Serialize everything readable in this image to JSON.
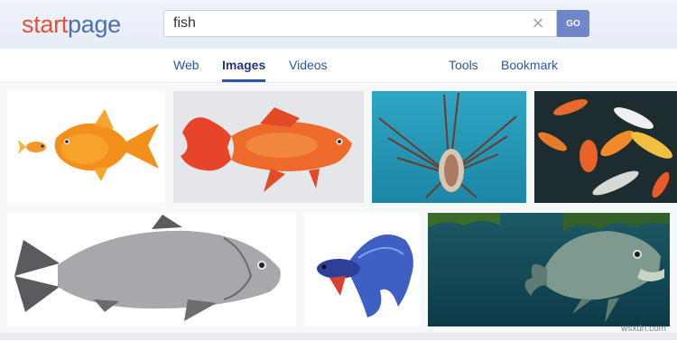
{
  "brand": {
    "logo_start": "start",
    "logo_page": "page",
    "logo_color_start": "#e8503a",
    "logo_color_page": "#4d6fb4"
  },
  "search": {
    "value": "fish",
    "placeholder": "",
    "go_label": "GO"
  },
  "nav": {
    "web": "Web",
    "images": "Images",
    "videos": "Videos",
    "tools": "Tools",
    "bookmark": "Bookmark",
    "active": "Images"
  },
  "results": {
    "images": [
      {
        "subject": "two goldfish on white"
      },
      {
        "subject": "goldfish on white background"
      },
      {
        "subject": "lionfish underwater"
      },
      {
        "subject": "koi fish in pond"
      },
      {
        "subject": "carp fish on white"
      },
      {
        "subject": "blue betta fish"
      },
      {
        "subject": "salmon underwater"
      }
    ]
  },
  "watermark": "wsxdn.com"
}
